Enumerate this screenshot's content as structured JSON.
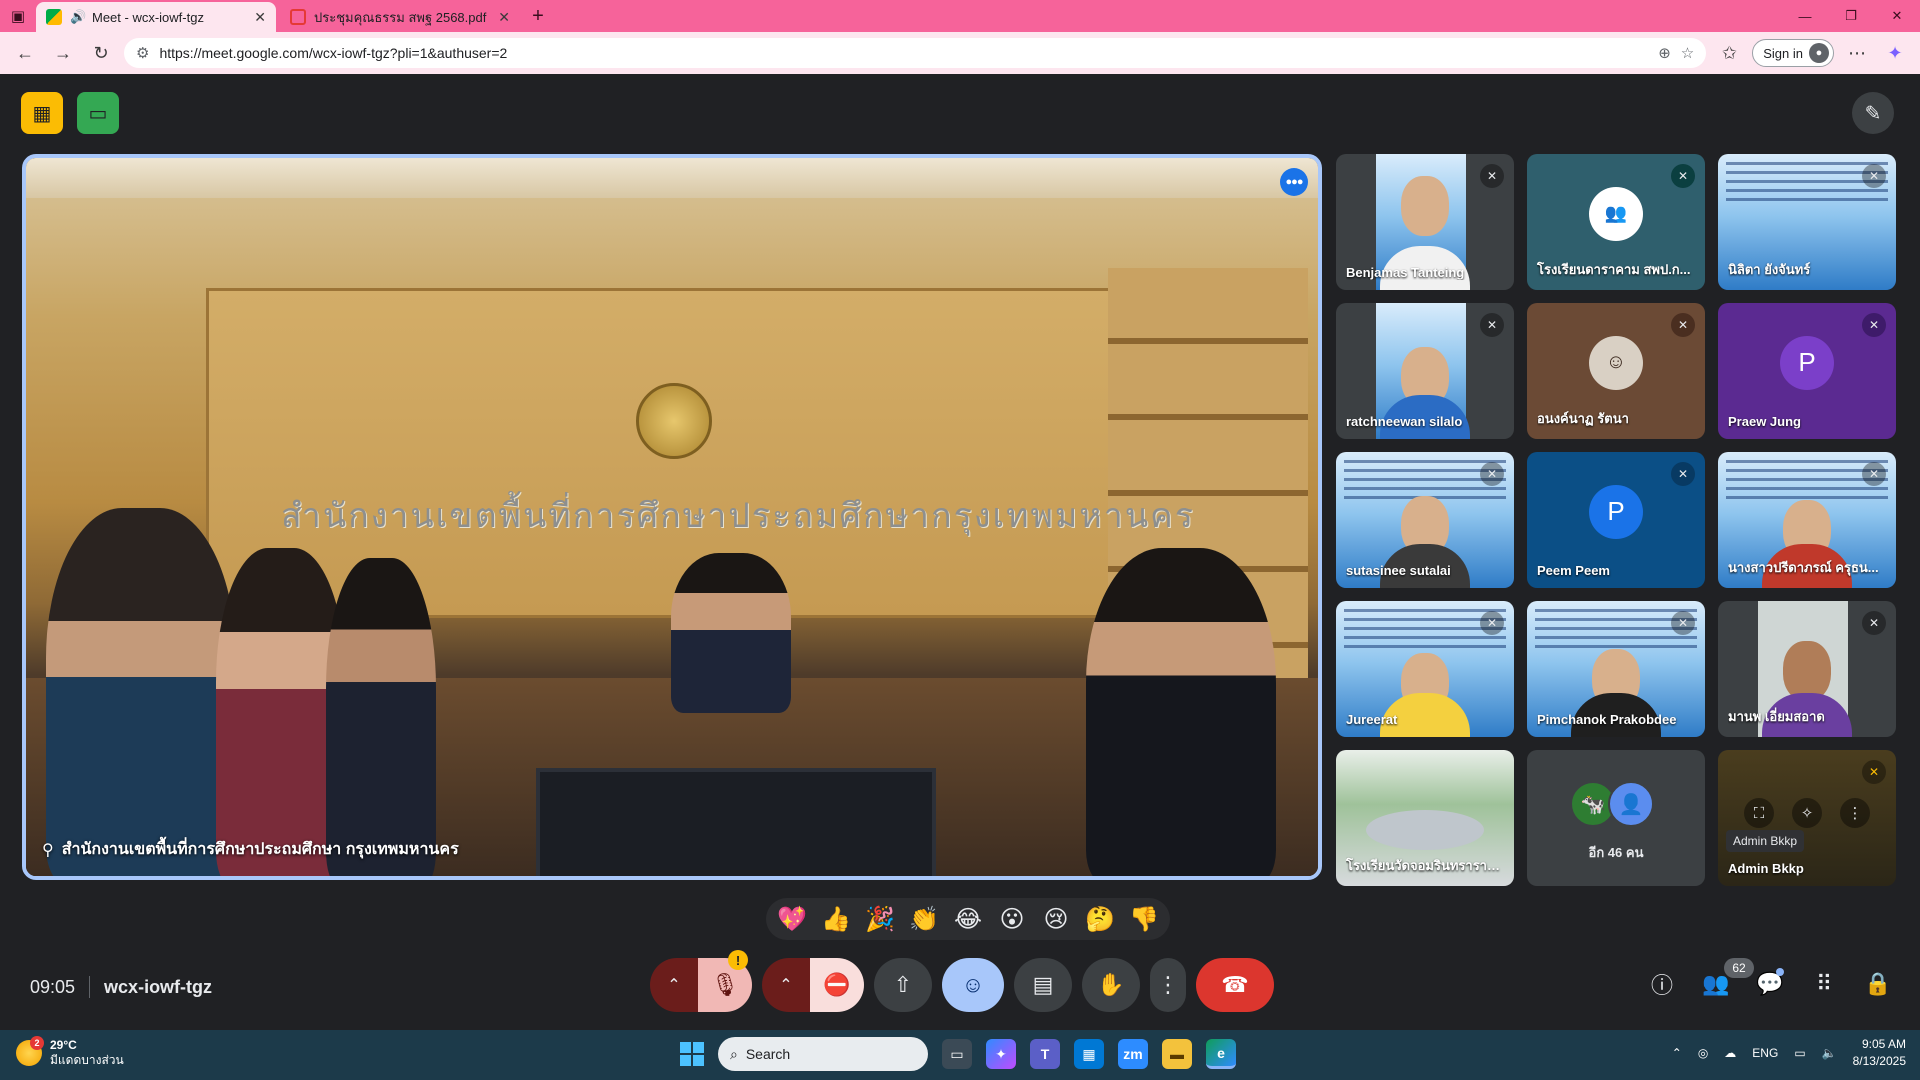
{
  "browser": {
    "tabs": [
      {
        "title": "Meet - wcx-iowf-tgz",
        "favicon_color": "#00ac47",
        "active": true
      },
      {
        "title": "ประชุมคุณธรรม สพฐ 2568.pdf",
        "favicon_color": "#e53935",
        "active": false
      }
    ],
    "new_tab_glyph": "+",
    "url": "https://meet.google.com/wcx-iowf-tgz?pli=1&authuser=2",
    "sign_in_label": "Sign in",
    "accent": "#f6639a"
  },
  "meet": {
    "main_speaker": {
      "name": "สำนักงานเขตพื้นที่การศึกษาประถมศึกษา กรุงเทพมหานคร",
      "wall_sign": "สำนักงานเขตพื้นที่การศึกษาประถมศึกษากรุงเทพมหานคร"
    },
    "participants": [
      {
        "name": "Benjamas Tanteing",
        "type": "video",
        "muted": true
      },
      {
        "name": "โรงเรียนดาราคาม สพป.ก...",
        "type": "photo",
        "muted": true
      },
      {
        "name": "นิลิตา ยังจันทร์",
        "type": "slide",
        "muted": true
      },
      {
        "name": "ratchneewan silalo",
        "type": "video",
        "muted": true
      },
      {
        "name": "อนงค์นาฏ รัตนา",
        "type": "photo",
        "muted": true
      },
      {
        "name": "Praew Jung",
        "type": "letter",
        "letter": "P",
        "color": "#7b3fc9",
        "muted": true
      },
      {
        "name": "sutasinee sutalai",
        "type": "video",
        "muted": true
      },
      {
        "name": "Peem Peem",
        "type": "letter",
        "letter": "P",
        "color": "#1a73e8",
        "muted": true
      },
      {
        "name": "นางสาวปรีดาภรณ์ ครุธน...",
        "type": "video",
        "muted": true
      },
      {
        "name": "Jureerat",
        "type": "video",
        "muted": true
      },
      {
        "name": "Pimchanok Prakobdee",
        "type": "video",
        "muted": true
      },
      {
        "name": "มานพ เอี่ยมสอาด",
        "type": "video",
        "muted": true
      },
      {
        "name": "โรงเรียนวัดจอมรินทราราม...",
        "type": "room",
        "muted": false
      },
      {
        "name": "อีก 46 คน",
        "type": "more",
        "muted": false
      },
      {
        "name": "Admin Bkkp",
        "type": "self",
        "muted": true,
        "tooltip": "Admin Bkkp"
      }
    ],
    "reactions": [
      "💖",
      "👍",
      "🎉",
      "👏",
      "😂",
      "😮",
      "😢",
      "🤔",
      "👎"
    ],
    "time": "09:05",
    "meeting_code": "wcx-iowf-tgz",
    "participant_count": "62",
    "mic_warning": "!"
  },
  "taskbar": {
    "weather_temp": "29°C",
    "weather_desc": "มีแดดบางส่วน",
    "weather_badge": "2",
    "search_label": "Search",
    "lang": "ENG",
    "clock_time": "9:05 AM",
    "clock_date": "8/13/2025",
    "zm_label": "zm"
  }
}
